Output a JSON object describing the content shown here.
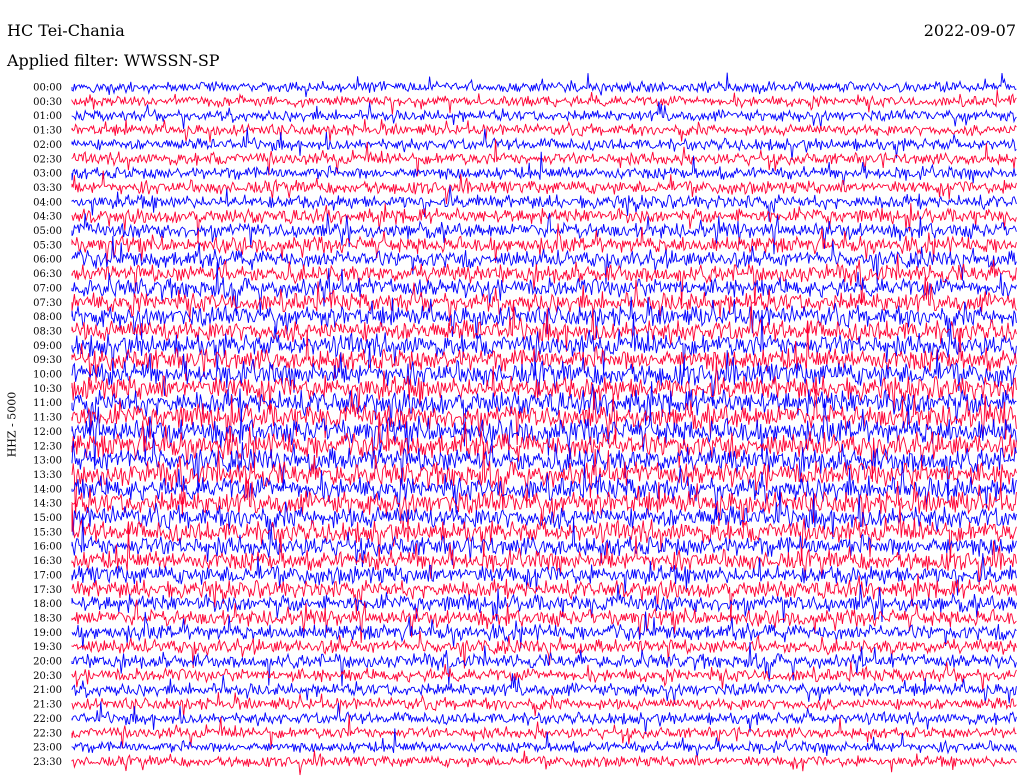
{
  "chart_data": {
    "type": "line",
    "title": "HC Tei-Chania",
    "subtitle": "Applied filter: WWSSN-SP",
    "date": "2022-09-07",
    "ylabel": "HHZ - 5000",
    "xlabel": "",
    "tick_labels": [
      "00:00",
      "00:30",
      "01:00",
      "01:30",
      "02:00",
      "02:30",
      "03:00",
      "03:30",
      "04:00",
      "04:30",
      "05:00",
      "05:30",
      "06:00",
      "06:30",
      "07:00",
      "07:30",
      "08:00",
      "08:30",
      "09:00",
      "09:30",
      "10:00",
      "10:30",
      "11:00",
      "11:30",
      "12:00",
      "12:30",
      "13:00",
      "13:30",
      "14:00",
      "14:30",
      "15:00",
      "15:30",
      "16:00",
      "16:30",
      "17:00",
      "17:30",
      "18:00",
      "18:30",
      "19:00",
      "19:30",
      "20:00",
      "20:30",
      "21:00",
      "21:30",
      "22:00",
      "22:30",
      "23:00",
      "23:30"
    ],
    "series_colors": [
      "#0000ff",
      "#ff0033"
    ],
    "grid": false,
    "legend": "none"
  }
}
